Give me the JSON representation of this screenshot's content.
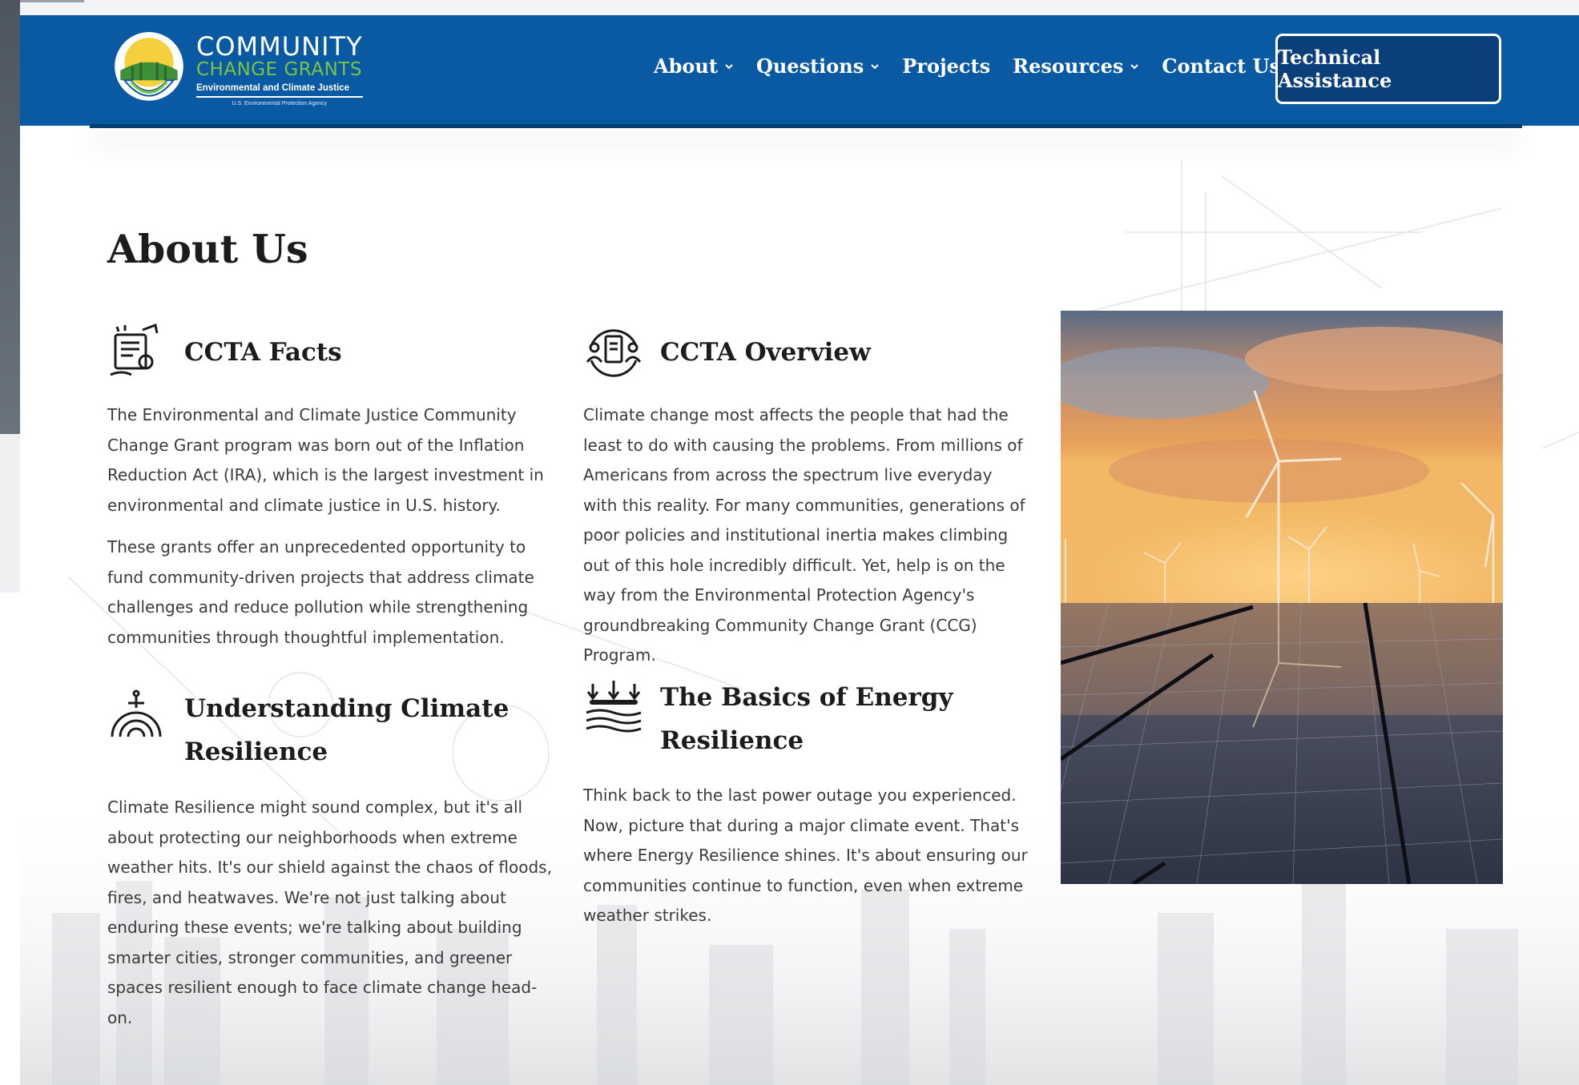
{
  "brand": {
    "line1": "COMMUNITY",
    "line2": "CHANGE GRANTS",
    "line3": "Environmental and Climate Justice",
    "line4": "U.S. Environmental Protection Agency"
  },
  "nav": {
    "items": [
      {
        "label": "About",
        "dropdown": true
      },
      {
        "label": "Questions",
        "dropdown": true
      },
      {
        "label": "Projects",
        "dropdown": false
      },
      {
        "label": "Resources",
        "dropdown": true
      },
      {
        "label": "Contact Us",
        "dropdown": false
      }
    ],
    "cta_label": "Technical Assistance"
  },
  "page": {
    "title": "About Us"
  },
  "sections": {
    "facts": {
      "title": "CCTA Facts",
      "icon": "certificate-icon",
      "paragraphs": [
        "The Environmental and Climate Justice Community Change Grant program was born out of the Inflation Reduction Act (IRA), which is the largest investment in environmental and climate justice in U.S. history.",
        "These grants offer an unprecedented opportunity to fund community-driven projects that address climate challenges and reduce pollution while strengthening communities through thoughtful implementation."
      ]
    },
    "overview": {
      "title": "CCTA Overview",
      "icon": "community-document-icon",
      "paragraphs": [
        "Climate change most affects the people that had the least to do with causing the problems. From millions of Americans from across the spectrum live everyday with this reality. For many communities, generations of poor policies and institutional inertia makes climbing out of this hole incredibly difficult. Yet, help is on the way from the Environmental Protection Agency's groundbreaking Community Change Grant (CCG) Program."
      ]
    },
    "climate": {
      "title": "Understanding Climate Resilience",
      "icon": "resilience-dome-icon",
      "paragraphs": [
        "Climate Resilience might sound complex, but it's all about protecting our neighborhoods when extreme weather hits. It's our shield against the chaos of floods, fires, and heatwaves. We're not just talking about enduring these events; we're talking about building smarter cities, stronger communities, and greener spaces resilient enough to face climate change head-on."
      ]
    },
    "energy": {
      "title": "The Basics of Energy Resilience",
      "icon": "energy-flow-icon",
      "paragraphs": [
        "Think back to the last power outage you experienced. Now, picture that during a major climate event. That's where Energy Resilience shines. It's about ensuring our communities continue to function, even when extreme weather strikes."
      ]
    }
  },
  "colors": {
    "header_bg": "#0a5aa3",
    "cta_bg": "#0a3f7a",
    "brand_green": "#7cc243",
    "heading": "#1c1c1c",
    "body_text": "#3b3b3b"
  }
}
